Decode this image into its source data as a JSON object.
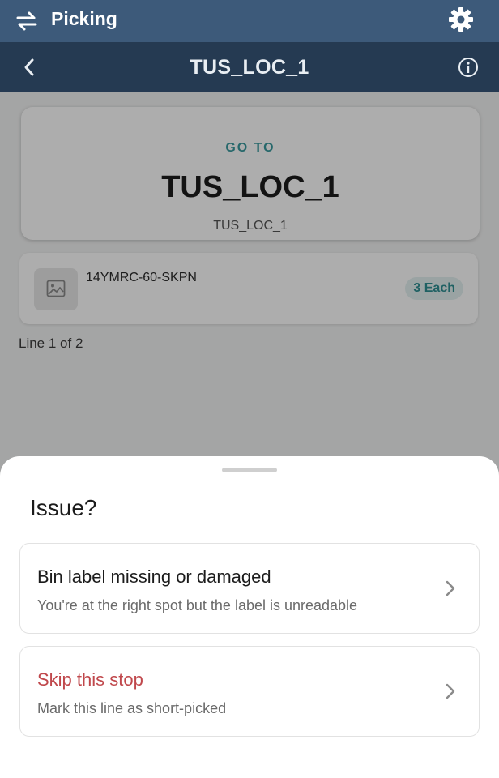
{
  "app": {
    "title": "Picking"
  },
  "header": {
    "location": "TUS_LOC_1"
  },
  "goto": {
    "label": "GO TO",
    "location": "TUS_LOC_1",
    "sublocation": "TUS_LOC_1"
  },
  "item": {
    "sku": "14YMRC-60-SKPN",
    "quantity": "3 Each"
  },
  "progress": {
    "line_text": "Line 1 of 2"
  },
  "sheet": {
    "title": "Issue?",
    "options": [
      {
        "title": "Bin label missing or damaged",
        "subtitle": "You're at the right spot but the label is unreadable"
      },
      {
        "title": "Skip this stop",
        "subtitle": "Mark this line as short-picked"
      }
    ]
  },
  "colors": {
    "appbar": "#3d5a7a",
    "subbar": "#253a52",
    "accent_teal": "#3a9a9e",
    "danger": "#c0484c"
  },
  "icons": {
    "swap": "swap-arrows-icon",
    "settings": "gear-icon",
    "back": "chevron-left-icon",
    "info": "info-icon",
    "image": "image-placeholder-icon",
    "option_chevron": "chevron-right-icon"
  }
}
